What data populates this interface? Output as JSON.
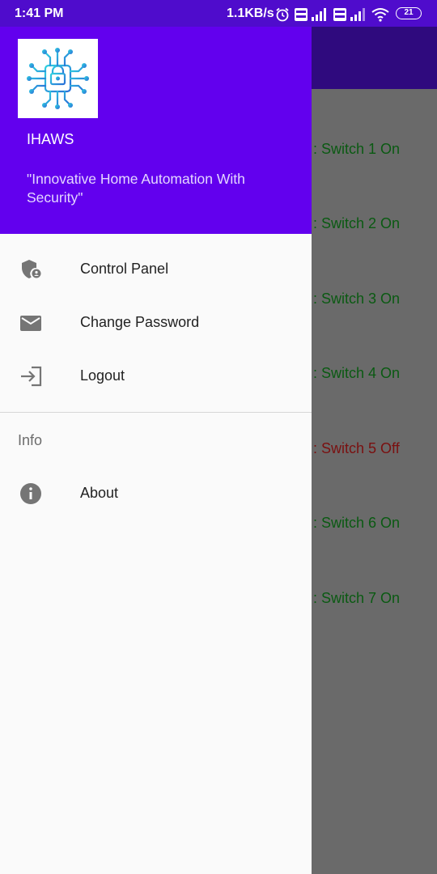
{
  "status_bar": {
    "time": "1:41 PM",
    "network_speed": "1.1KB/s",
    "battery": "21",
    "icons": [
      "alarm-icon",
      "volte-icon",
      "signal-icon",
      "volte-icon",
      "signal-icon",
      "wifi-icon",
      "battery-icon"
    ]
  },
  "background": {
    "switches": [
      {
        "label": ": Switch 1 On",
        "state": "on"
      },
      {
        "label": ": Switch 2 On",
        "state": "on"
      },
      {
        "label": ": Switch 3 On",
        "state": "on"
      },
      {
        "label": ": Switch 4 On",
        "state": "on"
      },
      {
        "label": ": Switch 5 Off",
        "state": "off"
      },
      {
        "label": ": Switch 6 On",
        "state": "on"
      },
      {
        "label": ": Switch 7 On",
        "state": "on"
      }
    ]
  },
  "drawer": {
    "header": {
      "logo_icon": "circuit-lock-icon",
      "app_name": "IHAWS",
      "tagline": "\"Innovative Home Automation With Security\""
    },
    "menu": [
      {
        "label": "Control Panel",
        "icon": "shield-user-icon"
      },
      {
        "label": "Change Password",
        "icon": "mail-icon"
      },
      {
        "label": "Logout",
        "icon": "logout-icon"
      }
    ],
    "section_header": "Info",
    "info_menu": [
      {
        "label": "About",
        "icon": "info-icon"
      }
    ]
  },
  "colors": {
    "status_bar": "#4f0ccc",
    "drawer_header": "#6200ee",
    "switch_on": "#0a5a12",
    "switch_off": "#7a1010",
    "scrim": "#6a6a6a"
  }
}
